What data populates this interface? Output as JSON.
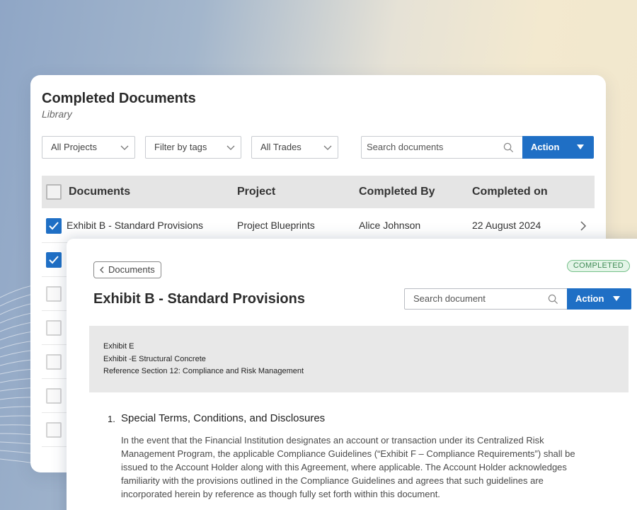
{
  "library": {
    "title": "Completed Documents",
    "subtitle": "Library",
    "filters": {
      "projects": "All Projects",
      "tags": "Filter by tags",
      "trades": "All Trades"
    },
    "search_placeholder": "Search documents",
    "action_label": "Action",
    "columns": [
      "Documents",
      "Project",
      "Completed By",
      "Completed on"
    ],
    "rows": [
      {
        "checked": true,
        "document": "Exhibit B - Standard Provisions",
        "project": "Project Blueprints",
        "completed_by": "Alice Johnson",
        "completed_on": "22 August 2024"
      },
      {
        "checked": true
      },
      {
        "checked": false
      },
      {
        "checked": false
      },
      {
        "checked": false
      },
      {
        "checked": false
      },
      {
        "checked": false
      }
    ]
  },
  "document": {
    "back_label": "Documents",
    "status": "COMPLETED",
    "title": "Exhibit B - Standard Provisions",
    "search_placeholder": "Search document",
    "action_label": "Action",
    "exhibit_lines": [
      "Exhibit E",
      "Exhibit -E Structural Concrete",
      "Reference Section 12: Compliance and Risk Management"
    ],
    "section": {
      "number": "1.",
      "title": "Special Terms, Conditions, and Disclosures",
      "body": "In the event that the Financial Institution designates an account or transaction under its Centralized Risk Management Program, the applicable Compliance Guidelines (“Exhibit F – Compliance Requirements”) shall be issued to the Account Holder along with this Agreement, where applicable. The Account Holder acknowledges familiarity with the provisions outlined in the Compliance Guidelines and agrees that such guidelines are incorporated herein by reference as though fully set forth within this document."
    }
  },
  "colors": {
    "accent": "#1f6fc5",
    "status_green": "#3f8a55",
    "status_bg": "#e4f5e8"
  },
  "icons": [
    "chevron-down-icon",
    "search-icon",
    "caret-down-icon",
    "checkmark-icon",
    "chevron-right-icon",
    "chevron-left-icon"
  ]
}
